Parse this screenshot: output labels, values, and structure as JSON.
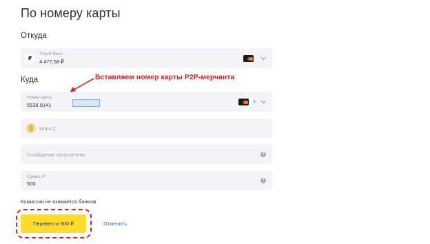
{
  "page": {
    "title": "По номеру карты"
  },
  "from": {
    "label": "Откуда",
    "currency_symbol": "₽",
    "card_name": "Tinkoff Black",
    "balance": "4 477,58 ₽"
  },
  "to": {
    "label": "Куда",
    "card_caption": "Номер карты",
    "card_number_prefix": "5536 9141"
  },
  "annotation": {
    "text": "Вставляем номер карты P2P-мерчанта"
  },
  "recipient": {
    "name_placeholder": "Илья С."
  },
  "message": {
    "placeholder": "Сообщение получателю"
  },
  "amount": {
    "caption": "Сумма, ₽",
    "value": "500"
  },
  "commission_note": "Комиссия не взимается банком",
  "actions": {
    "submit_label": "Перевести 500 ₽",
    "cancel_label": "Отменить"
  },
  "colors": {
    "accent_yellow": "#ffdd2d",
    "link_blue": "#336fee",
    "annotation_red": "#e21b1b",
    "field_bg": "#f2f4f8"
  }
}
